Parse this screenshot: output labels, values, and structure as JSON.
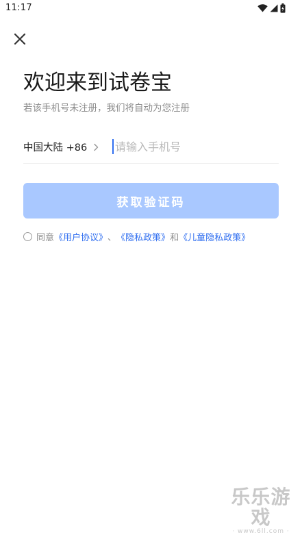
{
  "status_bar": {
    "time": "11:17",
    "icons": [
      "wifi-icon",
      "signal-icon",
      "battery-icon"
    ]
  },
  "close_icon": "close-icon",
  "title": "欢迎来到试卷宝",
  "subtitle": "若该手机号未注册，我们将自动为您注册",
  "phone": {
    "country_code": "中国大陆 +86",
    "value": "",
    "placeholder": "请输入手机号"
  },
  "code_button": {
    "label": "获取验证码"
  },
  "agreement": {
    "prefix": "同意",
    "user_agreement": "《用户协议》",
    "sep": "、",
    "privacy_policy": "《隐私政策》",
    "and": "和",
    "child_privacy": "《儿童隐私政策》"
  },
  "watermark": {
    "main": "乐乐游戏",
    "url": "· www.6ll.com ·"
  },
  "colors": {
    "accent": "#2f6ef0",
    "button_disabled": "#a9c8ff",
    "text_primary": "#1a1a1a",
    "text_secondary": "#8c8c8c",
    "placeholder": "#b8b8b8"
  }
}
